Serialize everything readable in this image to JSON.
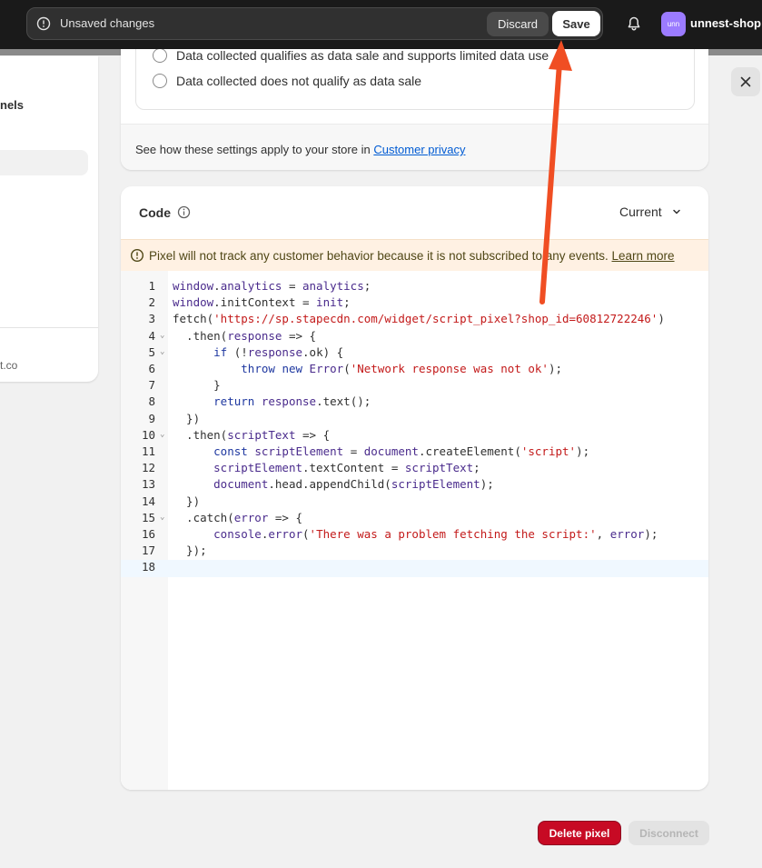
{
  "topbar": {
    "unsaved_message": "Unsaved changes",
    "discard_label": "Discard",
    "save_label": "Save",
    "store_avatar": "unn",
    "store_name": "unnest-shop"
  },
  "sidebar": {
    "partial_label": "nels",
    "footer_partial": "t.co"
  },
  "privacy": {
    "option_sale_limited": "Data collected qualifies as data sale and supports limited data use",
    "option_not_sale": "Data collected does not qualify as data sale",
    "footer_text": "See how these settings apply to your store in ",
    "footer_link": "Customer privacy"
  },
  "code_panel": {
    "title": "Code",
    "version_select": "Current",
    "banner_text": "Pixel will not track any customer behavior because it is not subscribed to any events. ",
    "banner_link": "Learn more"
  },
  "code_lines": [
    "window.analytics = analytics;",
    "window.initContext = init;",
    "fetch('https://sp.stapecdn.com/widget/script_pixel?shop_id=60812722246')",
    "  .then(response => {",
    "      if (!response.ok) {",
    "          throw new Error('Network response was not ok');",
    "      }",
    "      return response.text();",
    "  })",
    "  .then(scriptText => {",
    "      const scriptElement = document.createElement('script');",
    "      scriptElement.textContent = scriptText;",
    "      document.head.appendChild(scriptElement);",
    "  })",
    "  .catch(error => {",
    "      console.error('There was a problem fetching the script:', error);",
    "  });",
    ""
  ],
  "line_numbers": [
    "1",
    "2",
    "3",
    "4",
    "5",
    "6",
    "7",
    "8",
    "9",
    "10",
    "11",
    "12",
    "13",
    "14",
    "15",
    "16",
    "17",
    "18"
  ],
  "foldable_lines": [
    4,
    5,
    10,
    15
  ],
  "active_line": 18,
  "actions": {
    "delete_label": "Delete pixel",
    "disconnect_label": "Disconnect"
  },
  "colors": {
    "topbar": "#1a1a1a",
    "danger": "#c70a24",
    "annotation_arrow": "#f04e23",
    "link": "#005bd3"
  }
}
